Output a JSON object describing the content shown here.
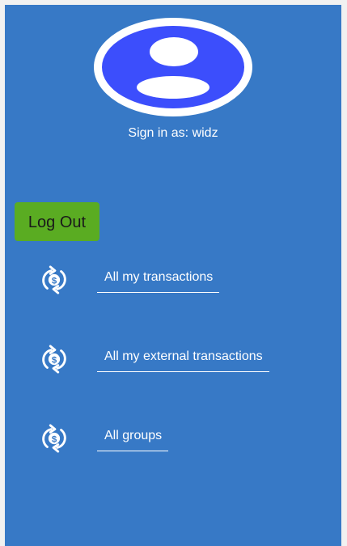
{
  "user": {
    "signin_text": "Sign in as: widz",
    "avatar_icon": "user-avatar-icon"
  },
  "actions": {
    "logout_label": "Log Out"
  },
  "nav": {
    "items": [
      {
        "label": "All my transactions",
        "icon": "dollar-cycle-icon"
      },
      {
        "label": "All my external transactions",
        "icon": "dollar-cycle-icon"
      },
      {
        "label": "All groups",
        "icon": "dollar-cycle-icon"
      }
    ]
  },
  "colors": {
    "panel": "#3779c6",
    "avatar_fill": "#3c4efc",
    "logout_button": "#5aac22",
    "text": "#ffffff"
  }
}
